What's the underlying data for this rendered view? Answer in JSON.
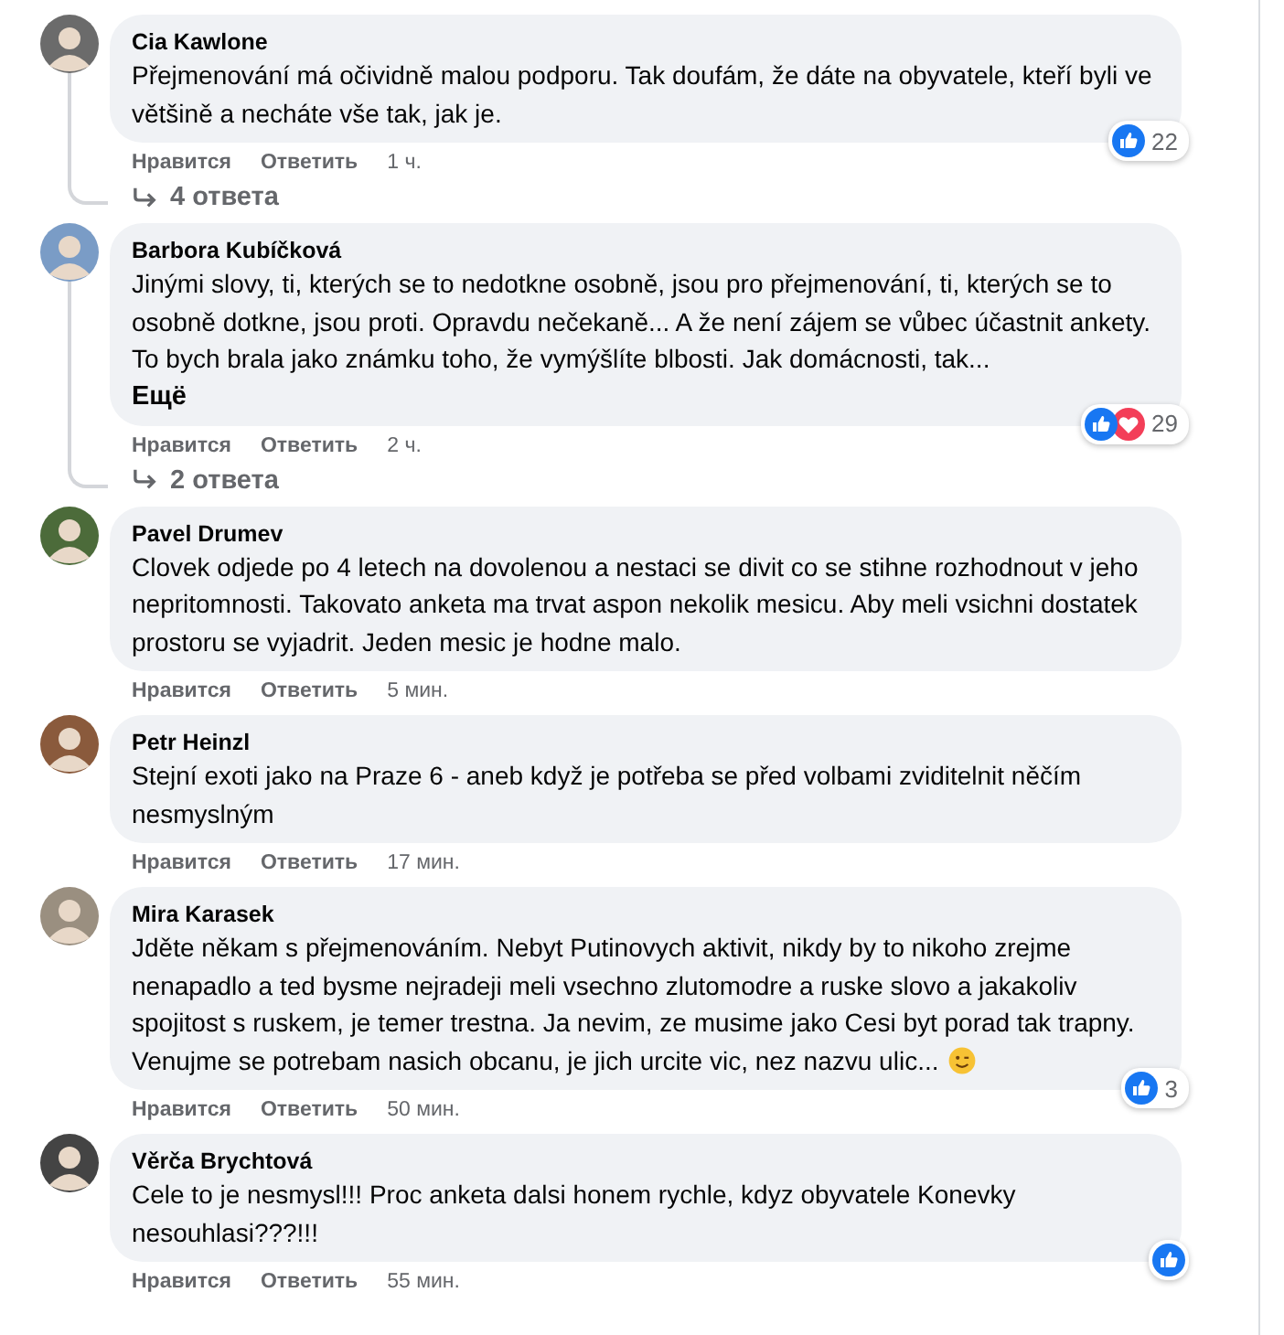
{
  "comments": [
    {
      "author": "Cia Kawlone",
      "text": "Přejmenování má očividně malou podporu. Tak doufám, že dáte na obyvatele, kteří byli ve většině a necháte vše tak, jak je.",
      "reactions": [
        {
          "kind": "like"
        }
      ],
      "reaction_count": "22",
      "actions": [
        "Нравится",
        "Ответить"
      ],
      "time": "1 ч.",
      "replies": "4 ответа"
    },
    {
      "author": "Barbora Kubíčková",
      "text": "Jinými slovy, ti, kterých se to nedotkne osobně, jsou pro přejmenování, ti, kterých se to osobně dotkne, jsou proti. Opravdu nečekaně... A že není zájem se vůbec účastnit ankety. To bych brala jako známku toho, že vymýšlíte blbosti. Jak domácnosti, tak...",
      "more": "Ещё",
      "reactions": [
        {
          "kind": "like"
        },
        {
          "kind": "love"
        }
      ],
      "reaction_count": "29",
      "actions": [
        "Нравится",
        "Ответить"
      ],
      "time": "2 ч.",
      "replies": "2 ответа"
    },
    {
      "author": "Pavel Drumev",
      "text": "Clovek odjede po 4 letech na dovolenou a nestaci se divit co se stihne rozhodnout v jeho nepritomnosti. Takovato anketa ma trvat aspon nekolik mesicu. Aby meli vsichni dostatek prostoru se vyjadrit. Jeden mesic je hodne malo.",
      "actions": [
        "Нравится",
        "Ответить"
      ],
      "time": "5 мин."
    },
    {
      "author": "Petr Heinzl",
      "text": "Stejní exoti jako na Praze 6 - aneb když je potřeba se před volbami zviditelnit něčím nesmyslným",
      "actions": [
        "Нравится",
        "Ответить"
      ],
      "time": "17 мин."
    },
    {
      "author": "Mira Karasek",
      "text": "Jděte někam s přejmenováním. Nebyt Putinovych aktivit, nikdy by to nikoho zrejme nenapadlo a ted bysme nejradeji meli vsechno zlutomodre a ruske slovo a jakakoliv spojitost s ruskem, je temer trestna. Ja nevim, ze musime jako Cesi byt porad tak trapny. Venujme se potrebam nasich obcanu, je jich urcite vic, nez nazvu ulic...",
      "emoji": {
        "kind": "wink"
      },
      "reactions": [
        {
          "kind": "like"
        }
      ],
      "reaction_count": "3",
      "actions": [
        "Нравится",
        "Ответить"
      ],
      "time": "50 мин."
    },
    {
      "author": "Věrča Brychtová",
      "text": "Cele to je nesmysl!!! Proc anketa dalsi honem rychle, kdyz obyvatele Konevky nesouhlasi???!!!",
      "reactions": [
        {
          "kind": "like"
        }
      ],
      "actions": [
        "Нравится",
        "Ответить"
      ],
      "time": "55 мин."
    }
  ]
}
